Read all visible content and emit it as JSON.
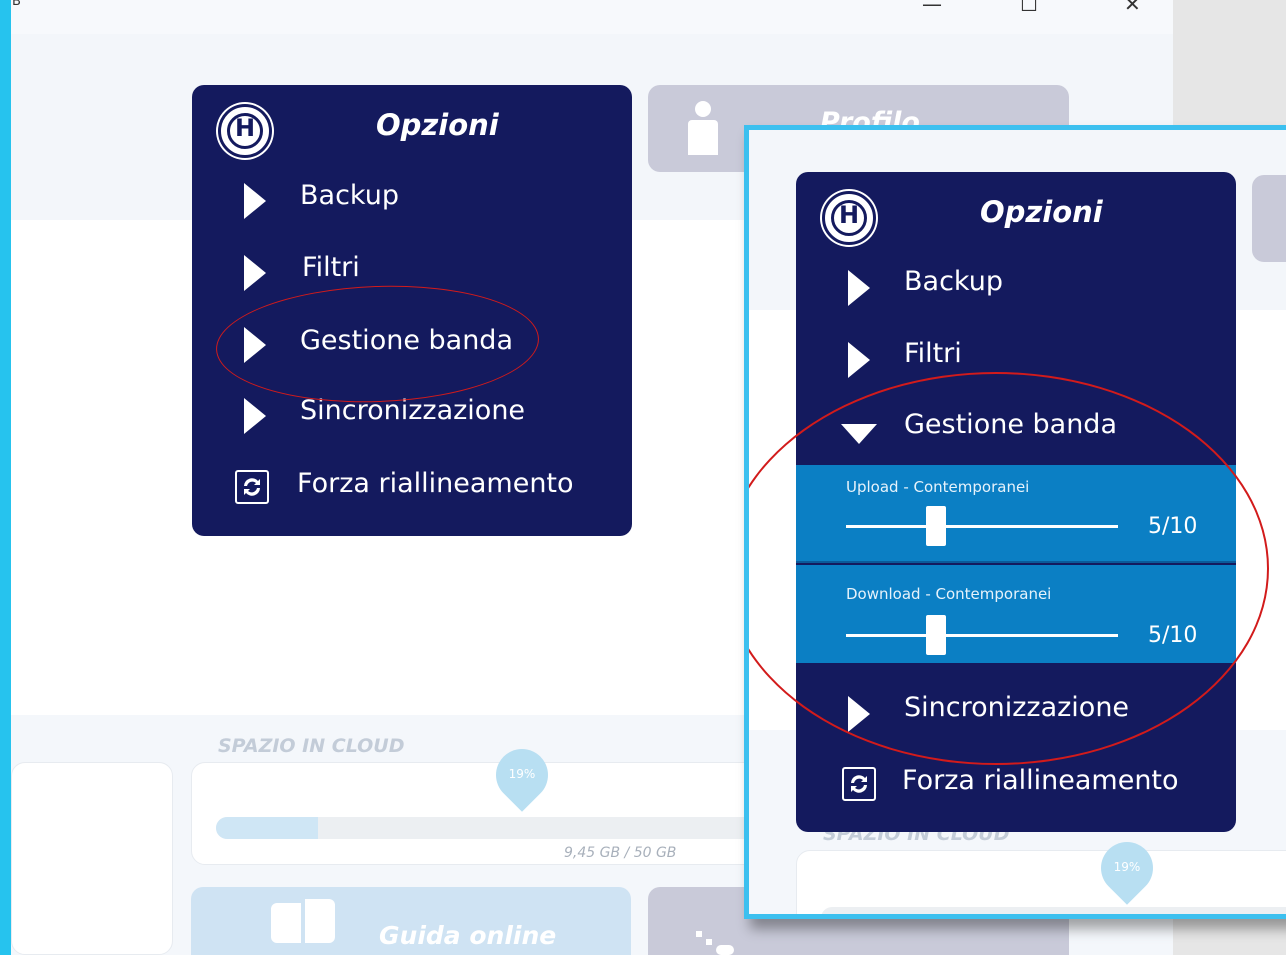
{
  "window": {
    "title_glyph": "B",
    "controls": {
      "minimize": "—",
      "maximize": "☐",
      "close": "✕"
    }
  },
  "menu": {
    "title": "Opzioni",
    "logo_letter": "H",
    "items": [
      {
        "label": "Backup",
        "icon": "triangle-right-icon"
      },
      {
        "label": "Filtri",
        "icon": "triangle-right-icon"
      },
      {
        "label": "Gestione banda",
        "icon": "triangle-right-icon"
      },
      {
        "label": "Sincronizzazione",
        "icon": "triangle-right-icon"
      },
      {
        "label": "Forza riallineamento",
        "icon": "refresh-icon"
      }
    ]
  },
  "profile_card": {
    "label": "Profilo",
    "icon": "person-icon"
  },
  "cloud": {
    "heading": "SPAZIO IN CLOUD",
    "percent_label": "19%",
    "used_fraction": 0.189,
    "storage_text": "9,45 GB / 50 GB"
  },
  "guide": {
    "label": "Guida online",
    "icon": "book-icon"
  },
  "zoom": {
    "menu_title": "Opzioni",
    "items": [
      {
        "label": "Backup",
        "state": "collapsed"
      },
      {
        "label": "Filtri",
        "state": "collapsed"
      },
      {
        "label": "Gestione banda",
        "state": "expanded"
      },
      {
        "label": "Sincronizzazione",
        "state": "collapsed"
      },
      {
        "label": "Forza riallineamento",
        "state": "action"
      }
    ],
    "sliders": [
      {
        "label": "Upload - Contemporanei",
        "value": 5,
        "max": 10,
        "display": "5/10"
      },
      {
        "label": "Download - Contemporanei",
        "value": 5,
        "max": 10,
        "display": "5/10"
      }
    ],
    "cloud_heading": "SPAZIO IN CLOUD",
    "percent_label": "19%"
  },
  "colors": {
    "menu_bg": "#141a5e",
    "slider_bg": "#0b7fc4",
    "annotation": "#d21b1b",
    "accent_cyan": "#26c3ee"
  }
}
